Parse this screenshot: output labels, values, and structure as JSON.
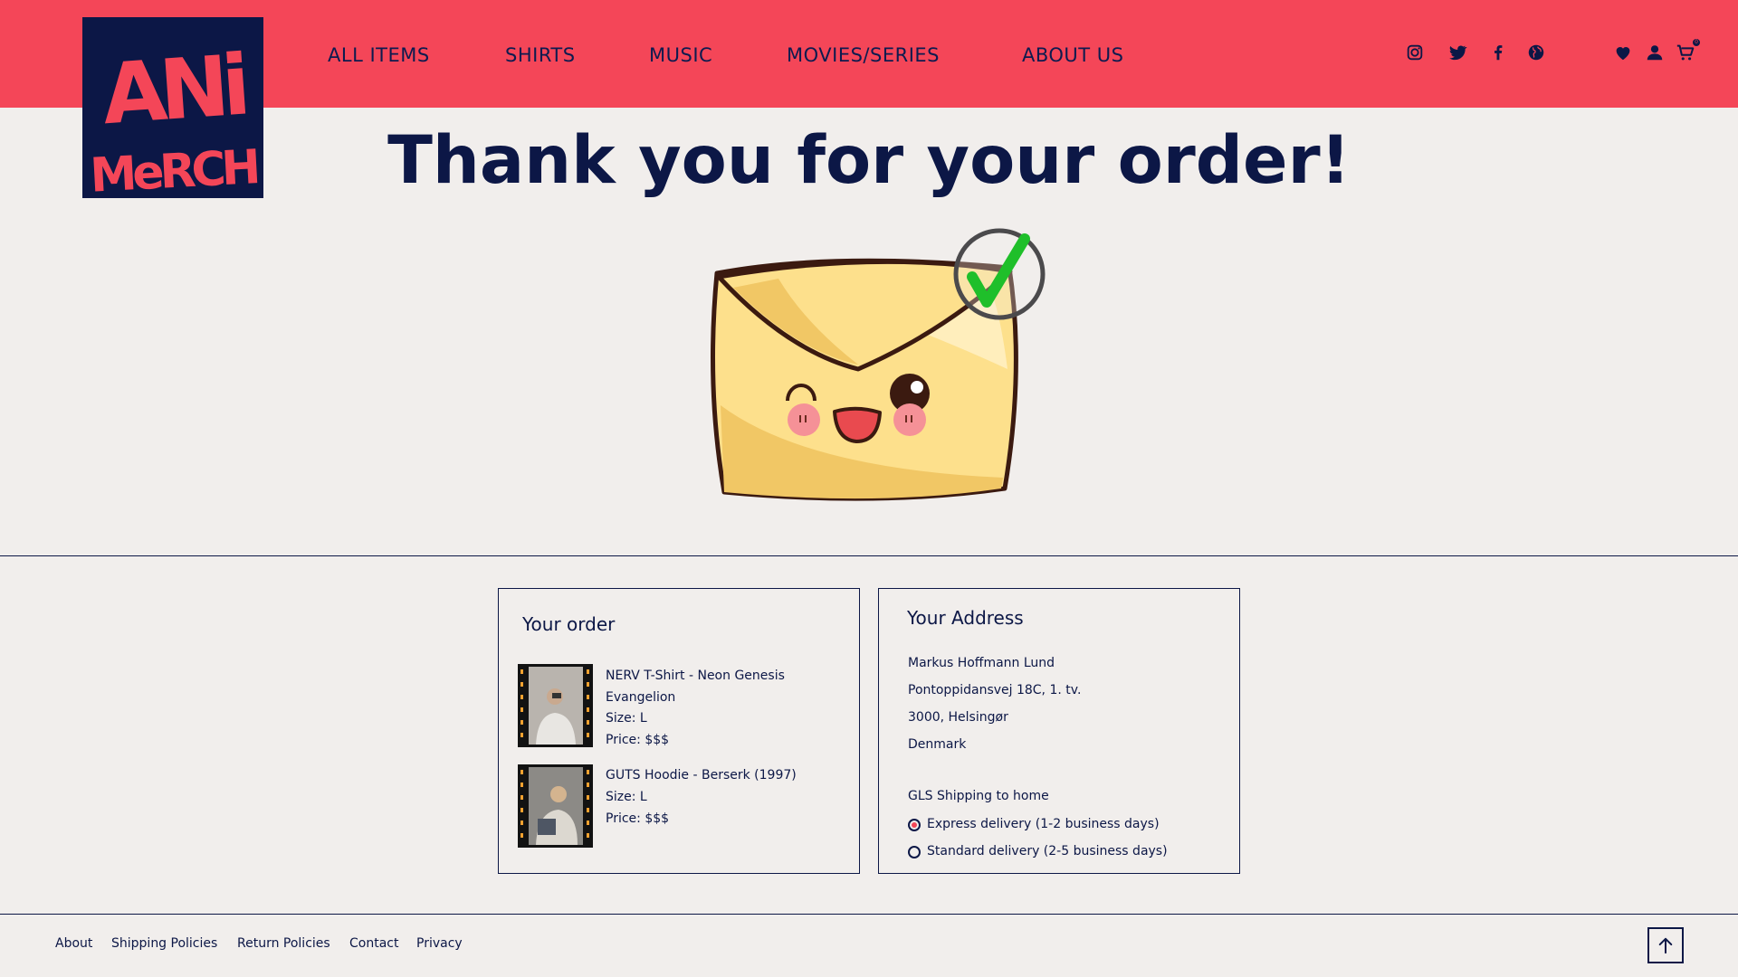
{
  "brand": {
    "logo_line1": "ANi",
    "logo_line2": "MeRCH",
    "colors": {
      "header": "#f44658",
      "navy": "#0c1746",
      "background": "#f1eeec",
      "check": "#1fbf2a"
    }
  },
  "nav": {
    "items": [
      {
        "label": "ALL ITEMS"
      },
      {
        "label": "SHIRTS"
      },
      {
        "label": "MUSIC"
      },
      {
        "label": "MOVIES/SERIES"
      },
      {
        "label": "ABOUT US"
      }
    ],
    "social_icons": [
      "instagram-icon",
      "twitter-icon",
      "facebook-icon",
      "globe-icon"
    ],
    "user_icons": [
      "heart-icon",
      "user-icon",
      "cart-icon"
    ],
    "cart_count": "0"
  },
  "hero": {
    "title": "Thank you for your order!"
  },
  "order": {
    "title": "Your order",
    "items": [
      {
        "name_line1": "NERV T-Shirt - Neon Genesis",
        "name_line2": "Evangelion",
        "size": "Size: L",
        "price": "Price: $$$"
      },
      {
        "name_line1": "GUTS Hoodie - Berserk (1997)",
        "size": "Size: L",
        "price": "Price: $$$"
      }
    ]
  },
  "address": {
    "title": "Your Address",
    "name": "Markus Hoffmann Lund",
    "street": "Pontoppidansvej 18C, 1. tv.",
    "city": "3000, Helsingør",
    "country": "Denmark",
    "shipping_title": "GLS Shipping to home",
    "options": [
      {
        "label": "Express delivery (1-2 business days)",
        "selected": true
      },
      {
        "label": "Standard delivery (2-5 business days)",
        "selected": false
      }
    ]
  },
  "footer": {
    "links": [
      "About",
      "Shipping Policies",
      "Return Policies",
      "Contact",
      "Privacy"
    ],
    "back_to_top_icon": "arrow-up-icon"
  }
}
